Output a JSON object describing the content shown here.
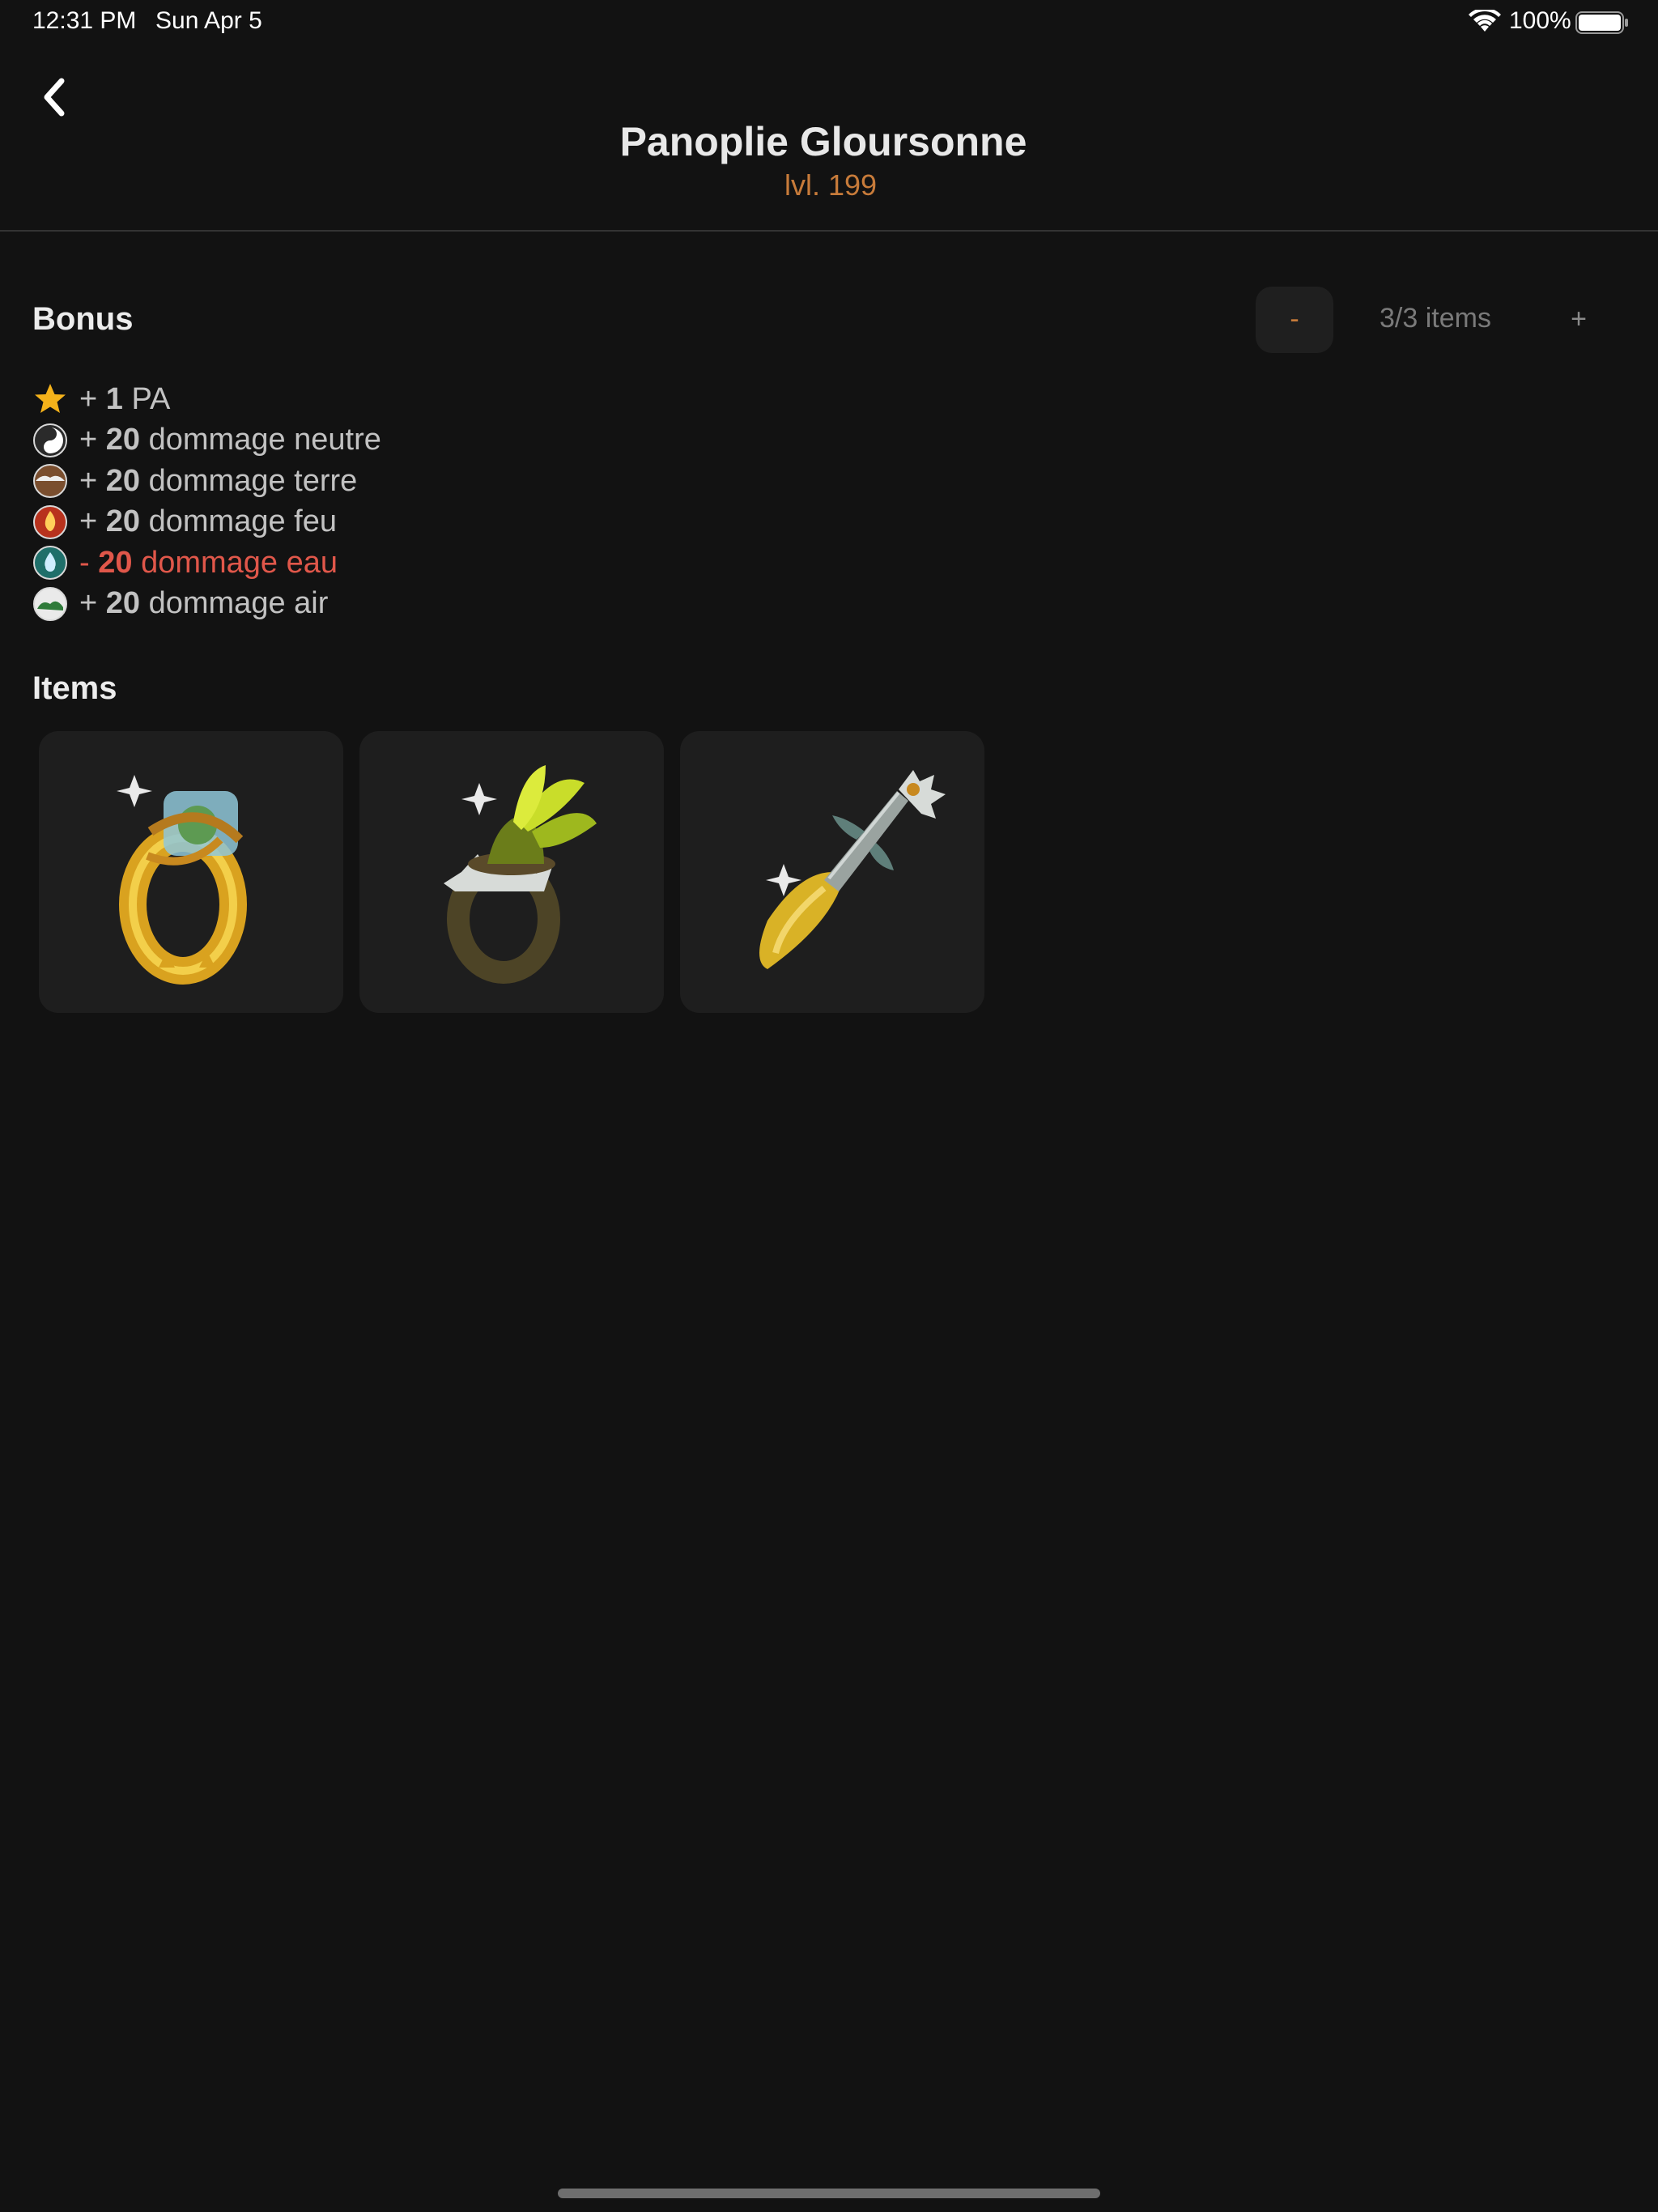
{
  "status_bar": {
    "time": "12:31 PM",
    "date": "Sun Apr 5",
    "battery": "100%",
    "icons": [
      "wifi-icon",
      "battery-icon"
    ]
  },
  "header": {
    "title": "Panoplie Gloursonne",
    "subtitle": "lvl. 199",
    "back_icon": "chevron-left-icon"
  },
  "bonus": {
    "title": "Bonus",
    "minus_label": "-",
    "count_label": "3/3 items",
    "plus_label": "+",
    "rows": [
      {
        "icon": "star-icon",
        "sign": "+",
        "value": "1",
        "label": "PA",
        "negative": false
      },
      {
        "icon": "neutral-element-icon",
        "sign": "+",
        "value": "20",
        "label": "dommage neutre",
        "negative": false
      },
      {
        "icon": "earth-element-icon",
        "sign": "+",
        "value": "20",
        "label": "dommage terre",
        "negative": false
      },
      {
        "icon": "fire-element-icon",
        "sign": "+",
        "value": "20",
        "label": "dommage feu",
        "negative": false
      },
      {
        "icon": "water-element-icon",
        "sign": "-",
        "value": "20",
        "label": "dommage eau",
        "negative": true
      },
      {
        "icon": "air-element-icon",
        "sign": "+",
        "value": "20",
        "label": "dommage air",
        "negative": false
      }
    ]
  },
  "items": {
    "title": "Items",
    "cards": [
      {
        "icon": "gold-ring-item-icon"
      },
      {
        "icon": "feather-ring-item-icon"
      },
      {
        "icon": "sword-item-icon"
      }
    ]
  },
  "colors": {
    "background": "#121212",
    "card": "#1e1e1e",
    "accent": "#c77b3a",
    "negative": "#e0574a",
    "text": "#c2c2c2"
  }
}
